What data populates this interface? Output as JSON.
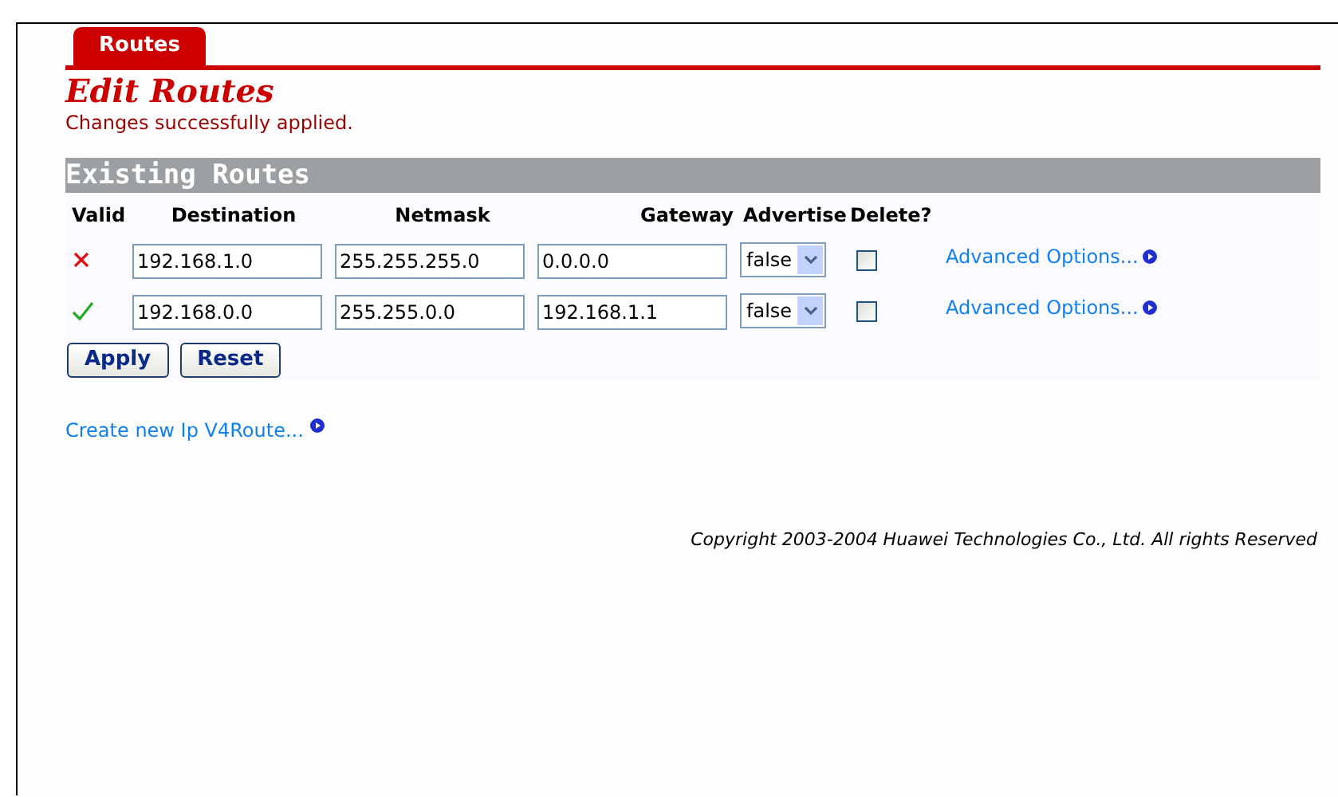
{
  "tabs": [
    {
      "label": "Routes",
      "selected": true
    }
  ],
  "title": "Edit Routes",
  "message": "Changes successfully applied.",
  "section_title": "Existing Routes",
  "columns": [
    "Valid",
    "Destination",
    "Netmask",
    "Gateway",
    "Advertise",
    "Delete?"
  ],
  "routes": [
    {
      "valid": false,
      "destination": "192.168.1.0",
      "netmask": "255.255.255.0",
      "gateway": "0.0.0.0",
      "advertise": "false",
      "delete": false,
      "link": "Advanced Options..."
    },
    {
      "valid": true,
      "destination": "192.168.0.0",
      "netmask": "255.255.0.0",
      "gateway": "192.168.1.1",
      "advertise": "false",
      "delete": false,
      "link": "Advanced Options..."
    }
  ],
  "buttons": [
    "Apply",
    "Reset"
  ],
  "create_link": "Create new Ip V4Route...",
  "copyright": "Copyright 2003-2004 Huawei Technologies Co., Ltd. All rights Reserved"
}
